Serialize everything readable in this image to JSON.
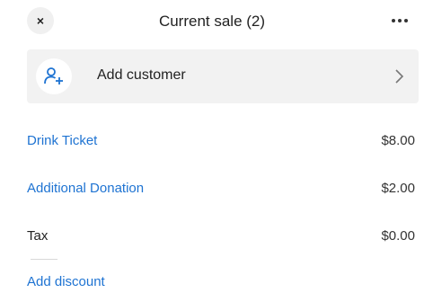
{
  "header": {
    "close_label": "×",
    "title": "Current sale (2)"
  },
  "customer": {
    "label": "Add customer"
  },
  "items": [
    {
      "name": "Drink Ticket",
      "price": "$8.00"
    },
    {
      "name": "Additional Donation",
      "price": "$2.00"
    }
  ],
  "tax": {
    "label": "Tax",
    "amount": "$0.00"
  },
  "discount": {
    "label": "Add discount"
  },
  "colors": {
    "link": "#1e73d2",
    "row_background": "#f2f2f2"
  },
  "icons": {
    "close": "close-icon",
    "more": "more-horizontal-icon",
    "add_customer": "person-add-icon",
    "chevron": "chevron-right-icon"
  }
}
